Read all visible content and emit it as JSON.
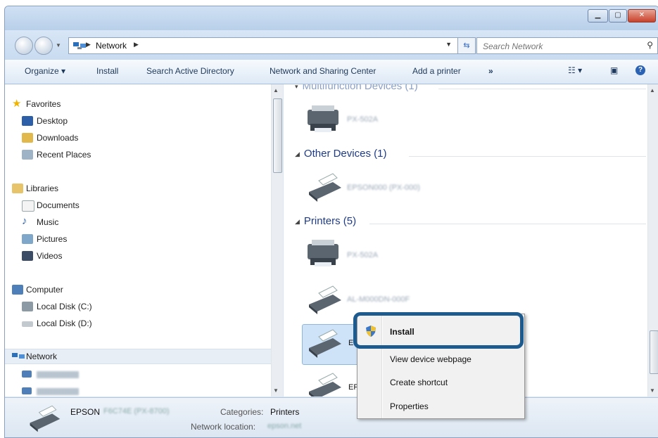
{
  "window": {
    "address": {
      "crumbs": [
        "Network"
      ]
    },
    "search_placeholder": "Search Network"
  },
  "toolbar": {
    "organize": "Organize ▾",
    "install": "Install",
    "search_ad": "Search Active Directory",
    "network_sharing": "Network and Sharing Center",
    "add_printer": "Add a printer",
    "more": "»"
  },
  "nav": {
    "favorites": "Favorites",
    "desktop": "Desktop",
    "downloads": "Downloads",
    "recent": "Recent Places",
    "libraries": "Libraries",
    "documents": "Documents",
    "music": "Music",
    "pictures": "Pictures",
    "videos": "Videos",
    "computer": "Computer",
    "disk_c": "Local Disk (C:)",
    "disk_d": "Local Disk (D:)",
    "network": "Network"
  },
  "content": {
    "groups": {
      "multifunction": "Multifunction Devices (1)",
      "other": "Other Devices (1)",
      "printers": "Printers (5)"
    },
    "selected_label_prefix": "EP",
    "last_label_prefix": "EPS"
  },
  "context_menu": {
    "install": "Install",
    "view_webpage": "View device webpage",
    "create_shortcut": "Create shortcut",
    "properties": "Properties"
  },
  "status": {
    "name_prefix": "EPSON",
    "categories_label": "Categories:",
    "categories_value": "Printers",
    "location_label": "Network location:"
  }
}
